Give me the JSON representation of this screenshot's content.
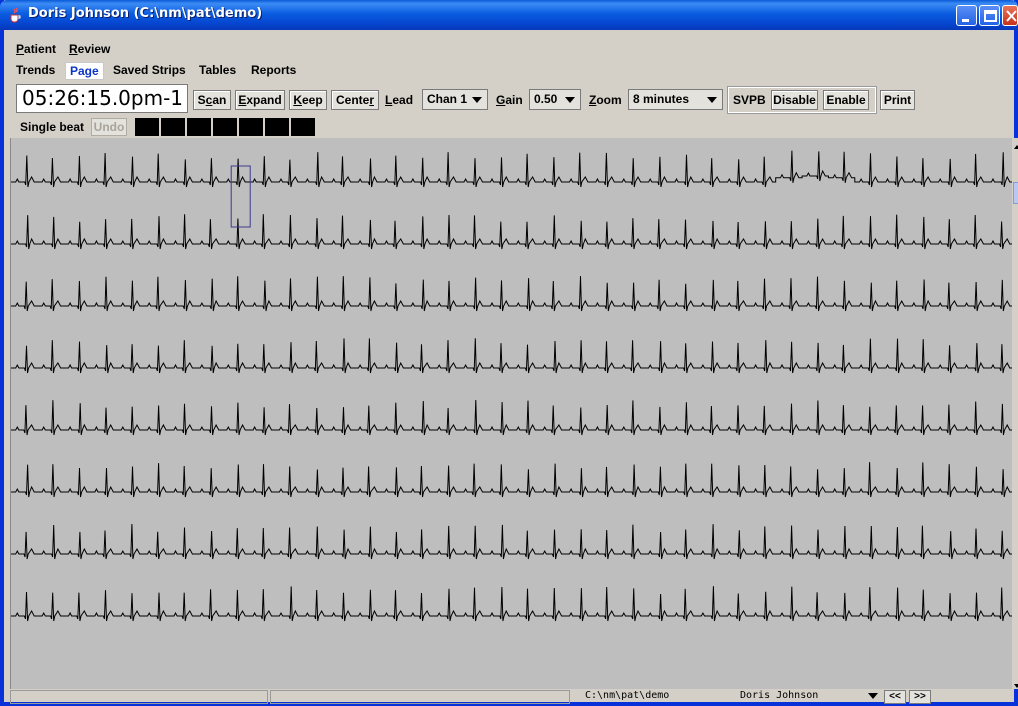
{
  "window": {
    "title": "Doris Johnson (C:\\nm\\pat\\demo)",
    "controls": [
      "minimize-icon",
      "maximize-icon",
      "close-icon"
    ]
  },
  "menu": [
    {
      "label": "Patient",
      "mnemonic": "P",
      "rest": "atient"
    },
    {
      "label": "Review",
      "mnemonic": "R",
      "rest": "eview"
    }
  ],
  "tabs": [
    {
      "label": "Trends",
      "active": false
    },
    {
      "label": "Page",
      "active": true
    },
    {
      "label": "Saved Strips",
      "active": false
    },
    {
      "label": "Tables",
      "active": false
    },
    {
      "label": "Reports",
      "active": false
    }
  ],
  "toolbar": {
    "time": "05:26:15.0pm-1",
    "scan": {
      "pre": "S",
      "u": "c",
      "post": "an"
    },
    "expand": {
      "pre": "",
      "u": "E",
      "post": "xpand"
    },
    "keep": {
      "pre": "",
      "u": "K",
      "post": "eep"
    },
    "center": {
      "pre": "Cente",
      "u": "r",
      "post": ""
    },
    "lead_label": {
      "pre": "",
      "u": "L",
      "post": "ead"
    },
    "lead_value": "Chan 1",
    "gain_label": {
      "pre": "",
      "u": "G",
      "post": "ain"
    },
    "gain_value": "0.50",
    "zoom_label": {
      "pre": "",
      "u": "Z",
      "post": "oom"
    },
    "zoom_value": "8 minutes",
    "svpb": "SVPB",
    "disable": "Disable",
    "enable": "Enable",
    "print": "Print"
  },
  "beat_bar": {
    "label": "Single beat",
    "undo": "Undo",
    "swatch_color": "#000000",
    "swatch_count": 7
  },
  "ecg": {
    "rows": 8,
    "beats_per_row": 38,
    "trace_color": "#000000",
    "background": "#bebebe",
    "selected_row": 1,
    "selected_beat": 9
  },
  "status": {
    "path": "C:\\nm\\pat\\demo",
    "user": "Doris Johnson",
    "prev": "<<",
    "next": ">>"
  }
}
